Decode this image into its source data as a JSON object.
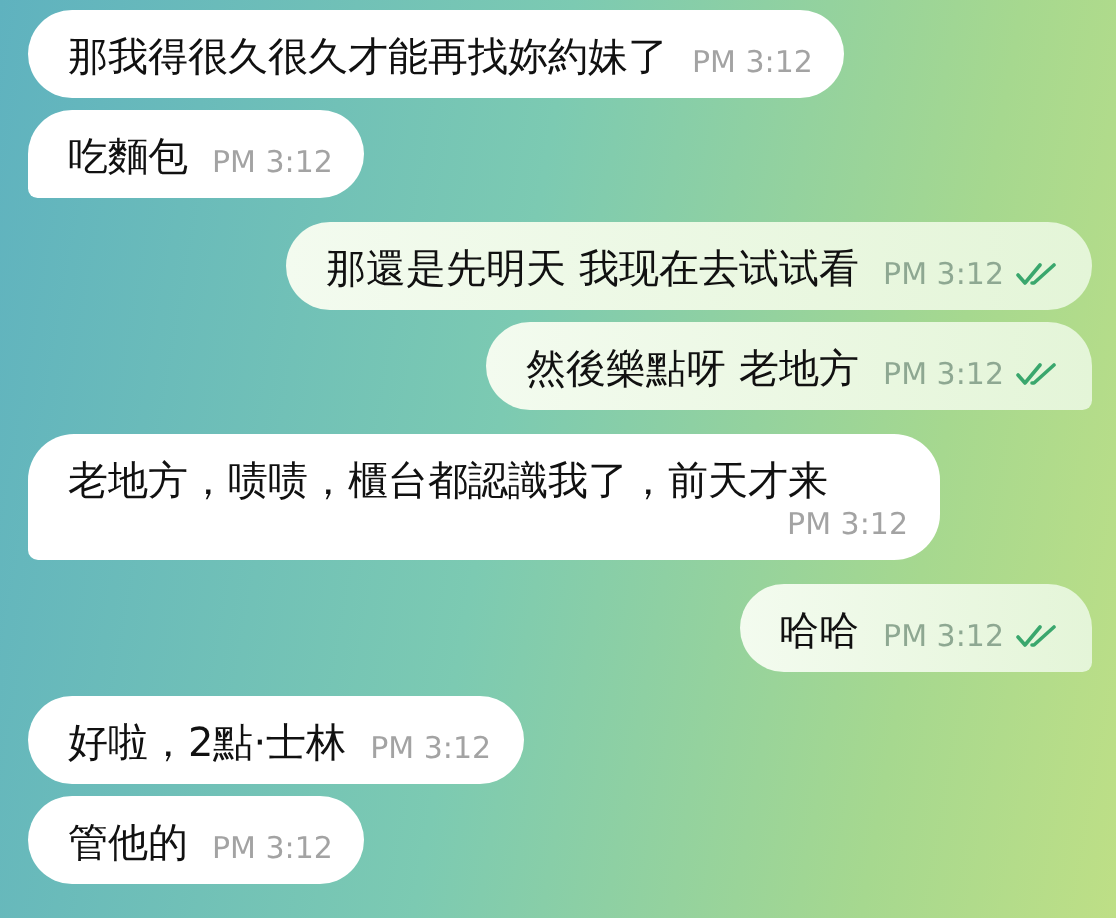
{
  "messages": [
    {
      "kind": "incoming",
      "text": "那我得很久很久才能再找妳約妹了",
      "time": "PM 3:12",
      "tail": false
    },
    {
      "kind": "incoming",
      "text": "吃麵包",
      "time": "PM 3:12",
      "tail": true
    },
    {
      "kind": "outgoing",
      "text": "那還是先明天 我现在去试试看",
      "time": "PM 3:12",
      "read": true,
      "tail": false
    },
    {
      "kind": "outgoing",
      "text": "然後樂點呀 老地方",
      "time": "PM 3:12",
      "read": true,
      "tail": true
    },
    {
      "kind": "incoming",
      "text": "老地方，啧啧，櫃台都認識我了，前天才来",
      "time": "PM 3:12",
      "tail": true
    },
    {
      "kind": "outgoing",
      "text": "哈哈",
      "time": "PM 3:12",
      "read": true,
      "tail": true
    },
    {
      "kind": "incoming",
      "text": "好啦，2點·士林",
      "time": "PM 3:12",
      "tail": false
    },
    {
      "kind": "incoming",
      "text": "管他的",
      "time": "PM 3:12",
      "tail": false
    }
  ]
}
